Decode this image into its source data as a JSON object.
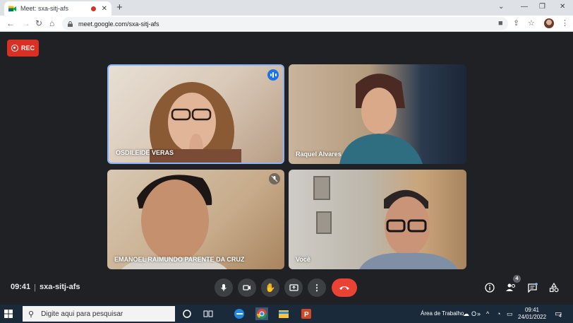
{
  "browser": {
    "tab_title": "Meet: sxa-sitj-afs",
    "tab_close": "✕",
    "new_tab": "+",
    "url": "meet.google.com/sxa-sitj-afs"
  },
  "meet": {
    "rec_label": "REC",
    "participants": [
      {
        "name": "OSDILEIDE VERAS",
        "status": "speaking"
      },
      {
        "name": "Raquel Alvares",
        "status": ""
      },
      {
        "name": "EMANOEL RAIMUNDO PARENTE DA CRUZ",
        "status": "muted"
      },
      {
        "name": "Você",
        "status": ""
      }
    ],
    "time": "09:41",
    "separator": "|",
    "meeting_code": "sxa-sitj-afs",
    "people_count": "4"
  },
  "taskbar": {
    "search_placeholder": "Digite aqui para pesquisar",
    "desktop_label": "Área de Trabalho",
    "time": "09:41",
    "date": "24/01/2022",
    "notif_count": "4"
  },
  "colors": {
    "meet_bg": "#202124",
    "rec_red": "#d93025",
    "hangup_red": "#ea4335",
    "speaking_blue": "#1a73e8",
    "active_border": "#8ab4f8"
  }
}
